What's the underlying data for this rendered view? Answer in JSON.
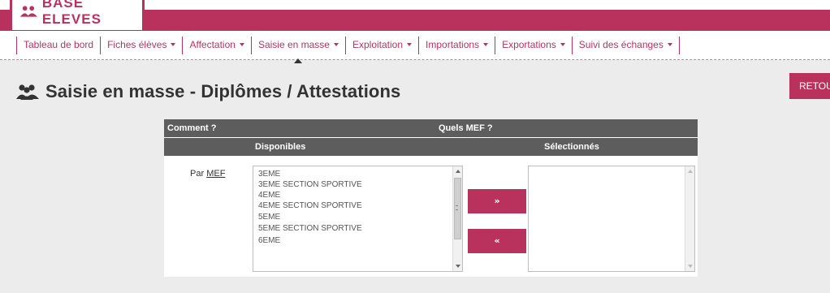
{
  "header": {
    "logo_text": "BASE ELEVES",
    "logo_icon": "people-group-icon",
    "brand_color": "#b9325e"
  },
  "nav": {
    "items": [
      {
        "label": "Tableau de bord",
        "dropdown": false
      },
      {
        "label": "Fiches élèves",
        "dropdown": true
      },
      {
        "label": "Affectation",
        "dropdown": true
      },
      {
        "label": "Saisie en masse",
        "dropdown": true,
        "active": true
      },
      {
        "label": "Exploitation",
        "dropdown": true
      },
      {
        "label": "Importations",
        "dropdown": true
      },
      {
        "label": "Exportations",
        "dropdown": true
      },
      {
        "label": "Suivi des échanges",
        "dropdown": true
      }
    ]
  },
  "page": {
    "title": "Saisie en masse - Diplômes / Attestations",
    "title_icon": "people-group-icon",
    "back_button_label": "RETOUR"
  },
  "panel": {
    "header_comment": "Comment ?",
    "header_mef": "Quels MEF ?",
    "col_available": "Disponibles",
    "col_selected": "Sélectionnés",
    "row_label_prefix": "Par ",
    "row_label_link": "MEF",
    "available_options": [
      "3EME",
      "3EME SECTION SPORTIVE",
      "4EME",
      "4EME SECTION SPORTIVE",
      "5EME",
      "5EME SECTION SPORTIVE",
      "6EME"
    ],
    "selected_options": [],
    "add_button_label": "»",
    "remove_button_label": "«",
    "header_color": "#5d5d5d"
  }
}
